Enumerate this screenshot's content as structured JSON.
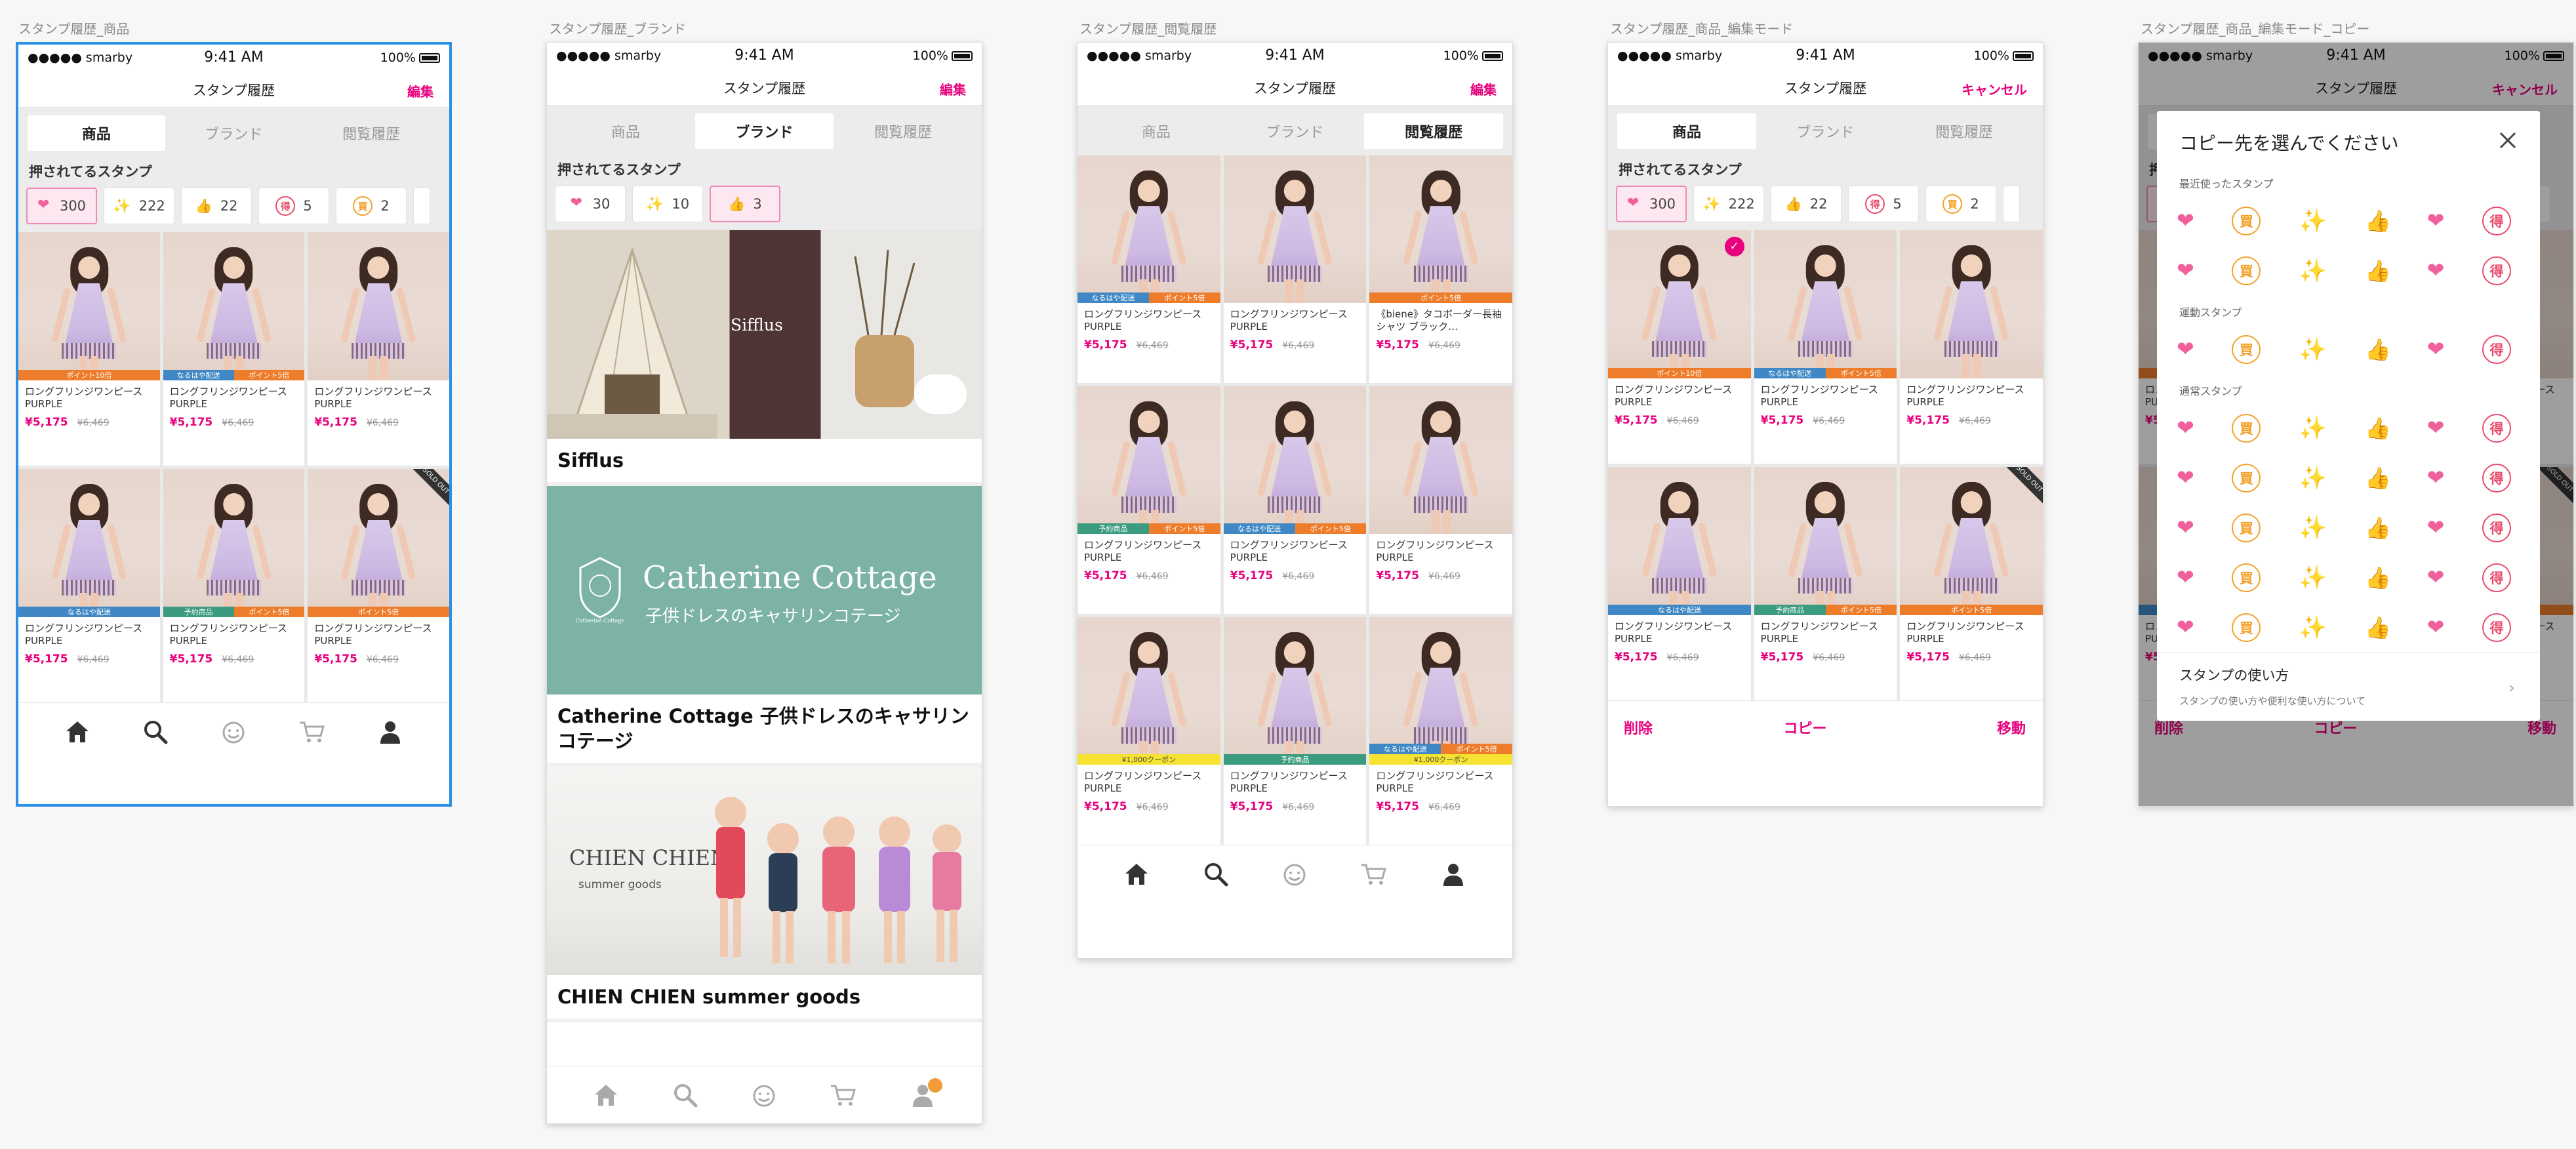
{
  "status": {
    "carrier": "●●●●● smarby",
    "time": "9:41 AM",
    "battery": "100%"
  },
  "nav_title": "スタンプ履歴",
  "nav_edit": "編集",
  "nav_cancel": "キャンセル",
  "tabs": [
    "商品",
    "ブランド",
    "閲覧履歴"
  ],
  "stamp_header": "押されてるスタンプ",
  "boards": [
    {
      "label": "スタンプ履歴_商品",
      "active_tab": "商品",
      "nav_action": "編集"
    },
    {
      "label": "スタンプ履歴_ブランド",
      "active_tab": "ブランド",
      "nav_action": "編集"
    },
    {
      "label": "スタンプ履歴_閲覧履歴",
      "active_tab": "閲覧履歴",
      "nav_action": "編集"
    },
    {
      "label": "スタンプ履歴_商品_編集モード",
      "active_tab": "商品",
      "nav_action": "キャンセル"
    },
    {
      "label": "スタンプ履歴_商品_編集モード_コピー",
      "active_tab": "商品",
      "nav_action": "キャンセル"
    }
  ],
  "stamp_chips_products": [
    {
      "icon": "heart-icon",
      "count": "300",
      "selected": true
    },
    {
      "icon": "sparkle-icon",
      "count": "222",
      "selected": false
    },
    {
      "icon": "thumbs-up-icon",
      "count": "22",
      "selected": false
    },
    {
      "icon": "toku-icon",
      "glyph": "得",
      "count": "5",
      "selected": false
    },
    {
      "icon": "kai-icon",
      "glyph": "買",
      "count": "2",
      "selected": false
    }
  ],
  "stamp_chips_brand": [
    {
      "icon": "heart-icon",
      "count": "30",
      "selected": false
    },
    {
      "icon": "sparkle-icon",
      "count": "10",
      "selected": false
    },
    {
      "icon": "thumbs-up-icon",
      "count": "3",
      "selected": true
    }
  ],
  "product": {
    "name": "ロングフリンジワンピース PURPLE",
    "price": "¥5,175",
    "old_price": "¥6,469"
  },
  "product_alt_names": {
    "biene": "《biene》タコボーダー長袖シャツ ブラック…"
  },
  "badges": {
    "point10": "ポイント10倍",
    "point5": "ポイント5倍",
    "express": "なるはや配送",
    "preorder": "予約商品",
    "coupon": "¥1,000クーポン",
    "soldout": "SOLD OUT"
  },
  "brands": [
    {
      "name": "Sifflus",
      "logo_text": "Sifflus"
    },
    {
      "name": "Catherine Cottage 子供ドレスのキャサリンコテージ",
      "logo_text": "Catherine Cottage",
      "logo_sub": "子供ドレスのキャサリンコテージ",
      "crest": "Catherine Cottage"
    },
    {
      "name": "CHIEN CHIEN summer goods",
      "logo_text": "CHIEN CHIEN",
      "logo_sub": "summer goods"
    }
  ],
  "bottom_actions": {
    "delete": "削除",
    "copy": "コピー",
    "move": "移動"
  },
  "copy_modal": {
    "title": "コピー先を選んでください",
    "sections": [
      "最近使ったスタンプ",
      "運動スタンプ",
      "通常スタンプ"
    ],
    "howto_title": "スタンプの使い方",
    "howto_sub": "スタンプの使い方や便利な使い方について"
  },
  "colors": {
    "accent": "#e8007d",
    "selection": "#2a8fe6",
    "brand_green": "#7cb3a6"
  }
}
